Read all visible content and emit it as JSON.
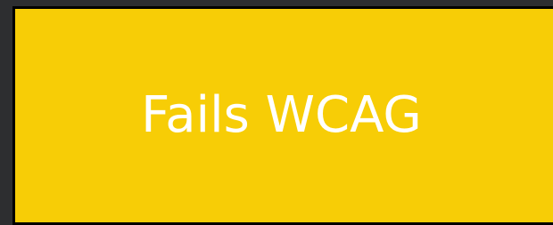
{
  "card": {
    "label": "Fails WCAG",
    "background_color": "#f7cd06",
    "text_color": "#ffffff",
    "border_color": "#000000"
  },
  "page": {
    "background_color": "#2d2e30"
  }
}
